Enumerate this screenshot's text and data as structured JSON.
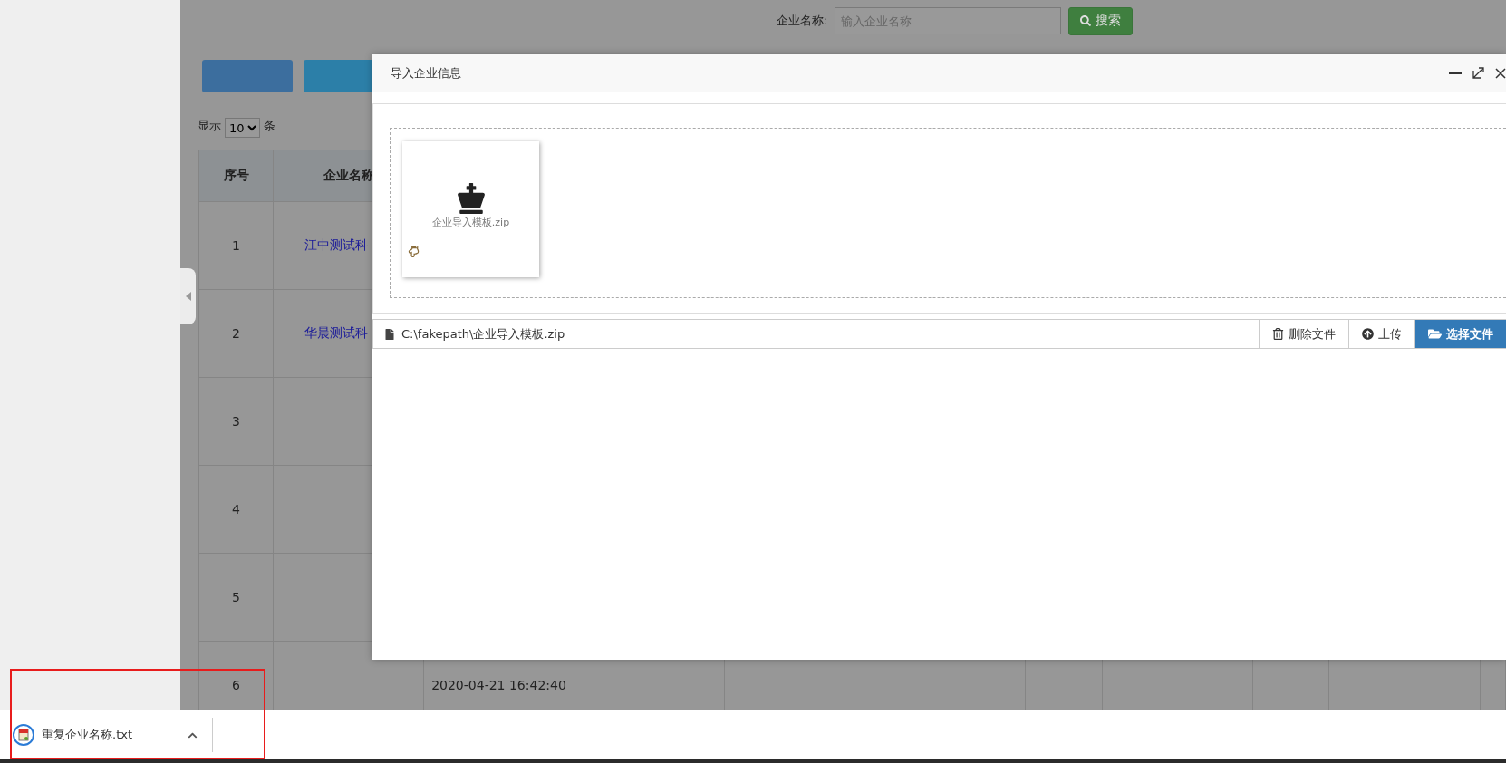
{
  "search": {
    "label": "企业名称:",
    "placeholder": "输入企业名称",
    "button": "搜索"
  },
  "page_size": {
    "prefix": "显示",
    "value": "10",
    "suffix": "条"
  },
  "table": {
    "columns": [
      "序号",
      "企业名称"
    ],
    "rows": [
      {
        "index": "1",
        "name": "江中测试科"
      },
      {
        "index": "2",
        "name": "华晨测试科"
      },
      {
        "index": "3"
      },
      {
        "index": "4"
      },
      {
        "index": "5"
      },
      {
        "index": "6",
        "date": "2020-04-21 16:42:40"
      }
    ]
  },
  "dialog": {
    "title": "导入企业信息",
    "preview": {
      "name": "企业导入模板.zip"
    },
    "file_path": "C:\\fakepath\\企业导入模板.zip",
    "buttons": [
      {
        "kind": "remove",
        "label": "删除文件"
      },
      {
        "kind": "upload",
        "label": "上传"
      },
      {
        "kind": "browse",
        "label": "选择文件"
      }
    ]
  },
  "download_bar": {
    "items": [
      {
        "name": "重复企业名称.txt"
      }
    ]
  }
}
